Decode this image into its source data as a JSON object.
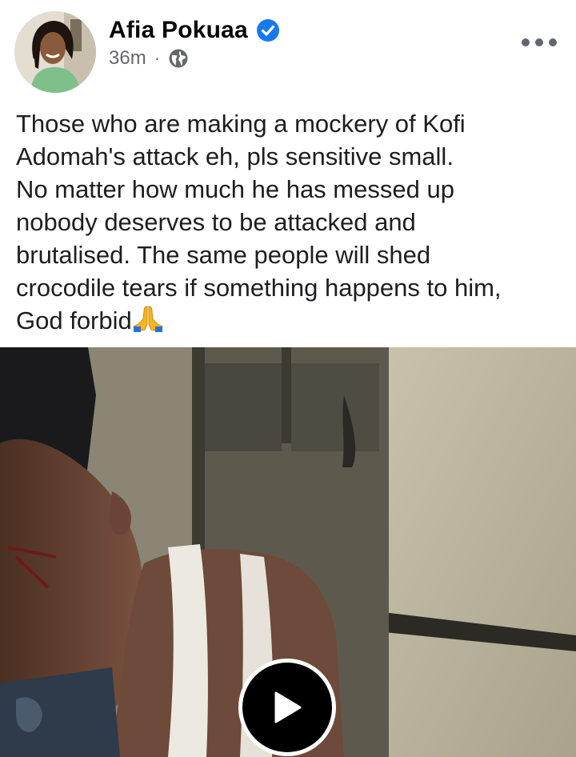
{
  "post": {
    "author": {
      "name": "Afia Pokuaa",
      "verified": true,
      "avatar_icon": "profile-photo"
    },
    "meta": {
      "time": "36m",
      "separator": "·",
      "audience_icon": "globe-icon"
    },
    "menu_icon": "more-options-icon",
    "text_lines": [
      "Those who are making a mockery of Kofi",
      "Adomah's attack eh, pls sensitive small.",
      "No matter how much he has messed up",
      "nobody deserves to be attacked and",
      "brutalised. The same people will shed",
      "crocodile tears if something happens to him,",
      "God forbid"
    ],
    "text_emoji": "praying-hands-emoji",
    "media": {
      "type": "video",
      "play_icon": "play-icon"
    }
  },
  "colors": {
    "verified_badge": "#1877f2",
    "primary_text": "#1c1e21",
    "secondary_text": "#65676b",
    "play_button": "#000000"
  }
}
